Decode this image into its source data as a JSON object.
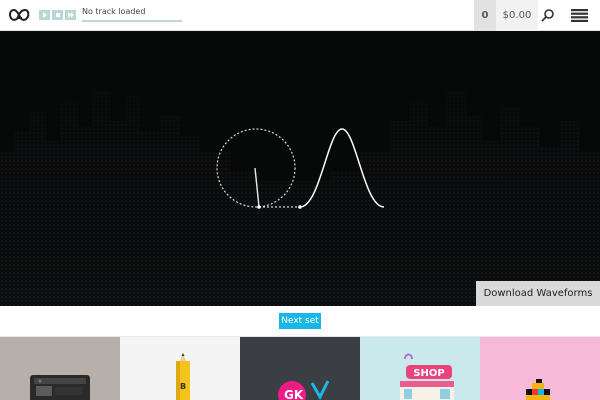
{
  "header": {
    "logo": "logo-icon",
    "controls": [
      "play-icon",
      "stop-icon",
      "next-icon"
    ],
    "track_label": "No track loaded",
    "cart_count": "0",
    "cart_total": "$0.00",
    "search_icon": "search-icon",
    "menu_icon": "hamburger-menu-icon"
  },
  "hero": {
    "download_label": "Download Waveforms"
  },
  "next_set_label": "Next set",
  "thumbnails": [
    {
      "name": "thumb-radio",
      "color": "#b6afaa"
    },
    {
      "name": "thumb-pencil",
      "color": "#f4f4f4"
    },
    {
      "name": "thumb-graffiti",
      "color": "#3b3e42"
    },
    {
      "name": "thumb-shop",
      "color": "#c9e9ec"
    },
    {
      "name": "thumb-pixel",
      "color": "#f7b9d8"
    }
  ],
  "thumb_texts": {
    "pencil": "B",
    "shop": "SHOP",
    "graffiti": "GK"
  },
  "colors": {
    "accent": "#19b6e8",
    "player_teal": "#b8d8d6",
    "hero_bg": "#070808"
  }
}
